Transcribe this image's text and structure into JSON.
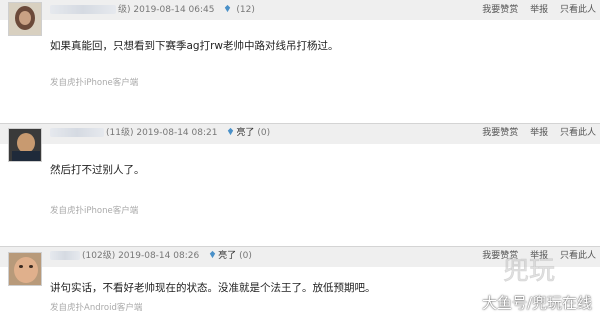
{
  "posts": [
    {
      "level": "级)",
      "time": "2019-08-14 06:45",
      "light_label": "",
      "light_count": "(12)",
      "actions": [
        "我要赞赏",
        "举报",
        "只看此人"
      ],
      "content": "如果真能回，只想看到下赛季ag打rw老帅中路对线吊打杨过。",
      "source": "发自虎扑iPhone客户端"
    },
    {
      "level": "(11级)",
      "time": "2019-08-14 08:21",
      "light_label": "亮了",
      "light_count": "(0)",
      "actions": [
        "我要赞赏",
        "举报",
        "只看此人"
      ],
      "content": "然后打不过别人了。",
      "source": "发自虎扑iPhone客户端"
    },
    {
      "level": "(102级)",
      "time": "2019-08-14 08:26",
      "light_label": "亮了",
      "light_count": "(0)",
      "actions": [
        "我要赞赏",
        "举报",
        "只看此人"
      ],
      "content": "讲句实话，不看好老帅现在的状态。没准就是个法王了。放低预期吧。",
      "source": "发自虎扑Android客户端"
    }
  ],
  "watermark": "大鱼号/兜玩在线",
  "watermark_logo_text": "兜玩",
  "colors": {
    "header_bg": "#efefef",
    "light_icon": "#4a90c8"
  },
  "icons": {
    "light": "lightbulb-icon"
  }
}
